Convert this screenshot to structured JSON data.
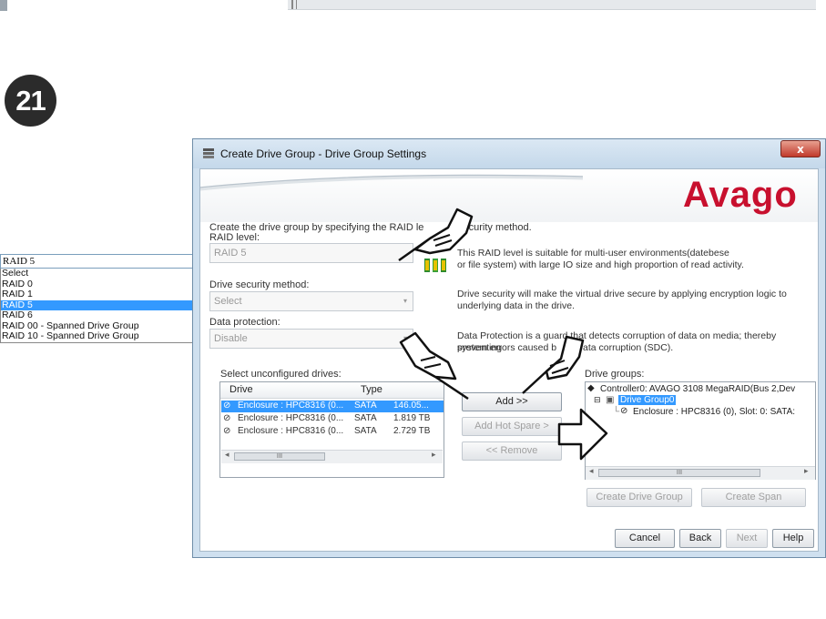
{
  "step_number": "21",
  "raid_dropdown": {
    "selected": "RAID 5",
    "options": [
      "Select",
      "RAID 0",
      "RAID 1",
      "RAID 5",
      "RAID 6",
      "RAID 00 - Spanned Drive Group",
      "RAID 10 - Spanned Drive Group"
    ],
    "highlighted_index": 3
  },
  "dialog": {
    "title": "Create Drive Group - Drive Group Settings",
    "close_label": "x",
    "brand": "Avago",
    "intro": "Create the drive group by specifying the RAID le",
    "intro_tail": "security method.",
    "raid_level_label": "RAID level:",
    "raid_level_value": "RAID 5",
    "raid_desc_1": "This RAID level is suitable for multi-user environments(datebese",
    "raid_desc_2": "or file system) with large IO size and high proportion of read activity.",
    "security_label": "Drive security method:",
    "security_value": "Select",
    "security_desc_1": "Drive security will make the virtual drive secure by applying encryption logic to",
    "security_desc_2": "underlying data in the drive.",
    "protection_label": "Data protection:",
    "protection_value": "Disable",
    "protection_desc_1": "Data Protection is a guard that detects corruption of data on media; thereby preventing",
    "protection_desc_2a": "system errors caused b",
    "protection_desc_2b": "ata corruption (SDC).",
    "unconfigured_label": "Select unconfigured drives:",
    "drive_columns": [
      "Drive",
      "Type"
    ],
    "drives": [
      {
        "name": "Enclosure : HPC8316 (0...",
        "type": "SATA",
        "size": "146.05...",
        "selected": true
      },
      {
        "name": "Enclosure : HPC8316 (0...",
        "type": "SATA",
        "size": "1.819 TB",
        "selected": false
      },
      {
        "name": "Enclosure : HPC8316 (0...",
        "type": "SATA",
        "size": "2.729 TB",
        "selected": false
      }
    ],
    "scroll_thumb": "III",
    "add_button": "Add >>",
    "hot_spare_button": "Add Hot Spare >",
    "remove_button": "<< Remove",
    "groups_label": "Drive groups:",
    "controller_node": "Controller0: AVAGO 3108 MegaRAID(Bus 2,Dev",
    "group_node": "Drive Group0",
    "drive_node": "Enclosure : HPC8316 (0), Slot: 0: SATA:",
    "create_group_button": "Create Drive Group",
    "create_span_button": "Create Span",
    "cancel_button": "Cancel",
    "back_button": "Back",
    "next_button": "Next",
    "help_button": "Help"
  },
  "colors": {
    "brand_red": "#c8102e",
    "selection_blue": "#3399ff",
    "dialog_frame": "#cfe0ef"
  }
}
